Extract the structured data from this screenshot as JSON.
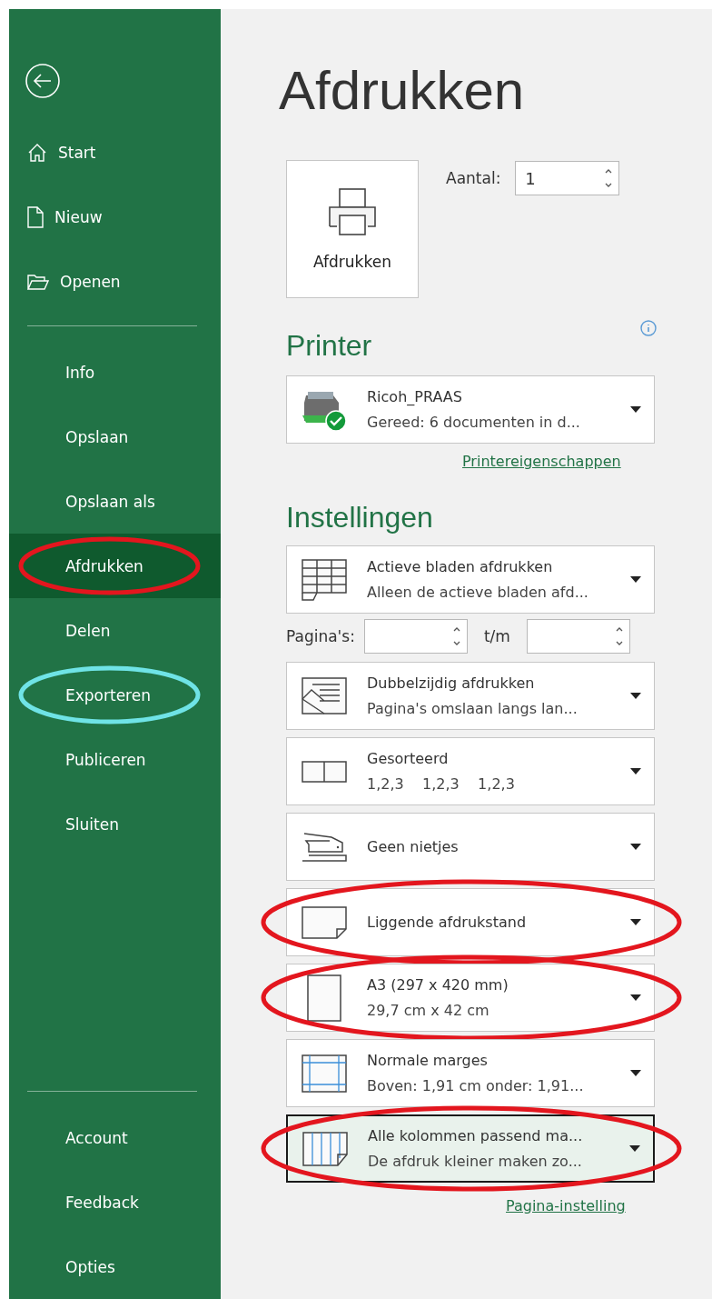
{
  "sidebar": {
    "nav_top": [
      {
        "kind": "home",
        "label": "Start",
        "selected": false
      },
      {
        "kind": "new",
        "label": "Nieuw",
        "selected": false
      },
      {
        "kind": "open",
        "label": "Openen",
        "selected": false
      }
    ],
    "nav_middle": [
      {
        "kind": "text",
        "label": "Info",
        "selected": false
      },
      {
        "kind": "text",
        "label": "Opslaan",
        "selected": false
      },
      {
        "kind": "text",
        "label": "Opslaan als",
        "selected": false
      },
      {
        "kind": "text",
        "label": "Afdrukken",
        "selected": true,
        "annotation": {
          "color": "#e3161e"
        }
      },
      {
        "kind": "text",
        "label": "Delen",
        "selected": false
      },
      {
        "kind": "text",
        "label": "Exporteren",
        "selected": false,
        "annotation": {
          "color": "#6fe3e6"
        }
      },
      {
        "kind": "text",
        "label": "Publiceren",
        "selected": false
      },
      {
        "kind": "text",
        "label": "Sluiten",
        "selected": false
      }
    ],
    "nav_bottom": [
      {
        "kind": "text",
        "label": "Account",
        "selected": false
      },
      {
        "kind": "text",
        "label": "Feedback",
        "selected": false
      },
      {
        "kind": "text",
        "label": "Opties",
        "selected": false
      }
    ]
  },
  "title": "Afdrukken",
  "print_button": {
    "label": "Afdrukken"
  },
  "copies": {
    "label": "Aantal:",
    "value": "1"
  },
  "printer": {
    "heading": "Printer",
    "name": "Ricoh_PRAAS",
    "status": "Gereed: 6 documenten in d...",
    "link": "Printereigenschappen"
  },
  "settings": {
    "heading": "Instellingen",
    "items": [
      {
        "kind": "sheets",
        "title": "Actieve bladen afdrukken",
        "subtitle": "Alleen de actieve bladen afd...",
        "selected": false
      },
      {
        "kind": "pages",
        "label": "Pagina's:",
        "to_label": "t/m"
      },
      {
        "kind": "duplex",
        "title": "Dubbelzijdig afdrukken",
        "subtitle": "Pagina's omslaan langs lan...",
        "selected": false
      },
      {
        "kind": "collate",
        "title": "Gesorteerd",
        "subtitle": "1,2,3    1,2,3    1,2,3",
        "selected": false
      },
      {
        "kind": "staple",
        "title": "Geen nietjes",
        "selected": false
      },
      {
        "kind": "orientation",
        "title": "Liggende afdrukstand",
        "selected": false,
        "annotation": {
          "color": "#e3161e"
        }
      },
      {
        "kind": "paper",
        "title": "A3 (297 x 420 mm)",
        "subtitle": "29,7 cm x 42 cm",
        "selected": false,
        "annotation": {
          "color": "#e3161e"
        }
      },
      {
        "kind": "margins",
        "title": "Normale marges",
        "subtitle": "Boven: 1,91 cm onder: 1,91...",
        "selected": false
      },
      {
        "kind": "scaling",
        "title": "Alle kolommen passend ma...",
        "subtitle": "De afdruk kleiner maken zo...",
        "selected": true,
        "annotation": {
          "color": "#e3161e"
        }
      }
    ],
    "link": "Pagina-instelling"
  }
}
